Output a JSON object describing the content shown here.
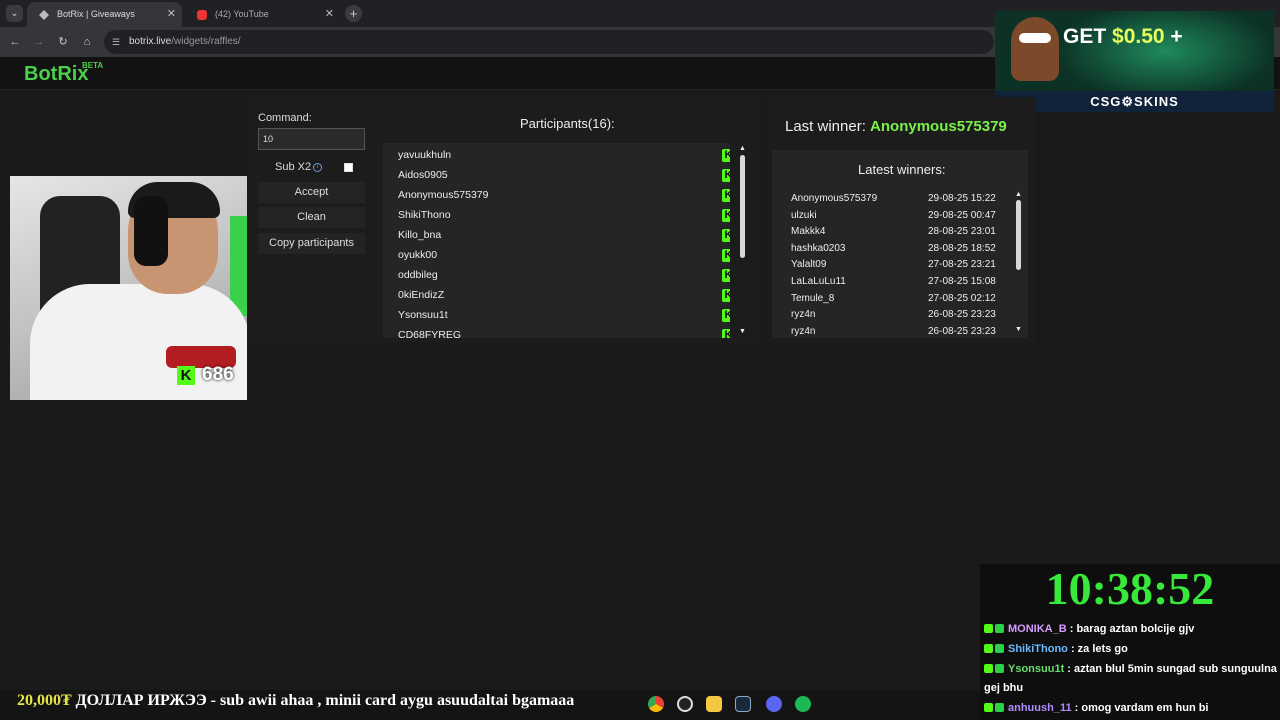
{
  "browser": {
    "tabs": [
      {
        "label": "BotRix | Giveaways"
      },
      {
        "label": "(42) YouTube"
      }
    ],
    "url_host": "botrix.live",
    "url_path": "/widgets/raffles/"
  },
  "header": {
    "logo": "BotRix",
    "beta": "BETA"
  },
  "ad": {
    "get": "GET",
    "amount": "$0.50",
    "plus": "+",
    "brand": "CSG⚙SKINS"
  },
  "controls": {
    "command_label": "Command:",
    "command_value": "10",
    "sub_label": "Sub X2",
    "accept": "Accept",
    "clean": "Clean",
    "copy": "Copy participants"
  },
  "participants": {
    "title": "Participants(16):",
    "items": [
      "yavuukhuln",
      "Aidos0905",
      "Anonymous575379",
      "ShikiThono",
      "Killo_bna",
      "oyukk00",
      "oddbileg",
      "0kiEndizZ",
      "Ysonsuu1t",
      "CD68FYREG"
    ]
  },
  "winners": {
    "last_label": "Last winner:",
    "last_name": "Anonymous575379",
    "title": "Latest winners:",
    "rows": [
      {
        "name": "Anonymous575379",
        "when": "29-08-25 15:22"
      },
      {
        "name": "ulzuki",
        "when": "29-08-25 00:47"
      },
      {
        "name": "Makkk4",
        "when": "28-08-25 23:01"
      },
      {
        "name": "hashka0203",
        "when": "28-08-25 18:52"
      },
      {
        "name": "Yalalt09",
        "when": "27-08-25 23:21"
      },
      {
        "name": "LaLaLuLu11",
        "when": "27-08-25 15:08"
      },
      {
        "name": "Temule_8",
        "when": "27-08-25 02:12"
      },
      {
        "name": "ryz4n",
        "when": "26-08-25 23:23"
      },
      {
        "name": "ryz4n",
        "when": "26-08-25 23:23"
      }
    ]
  },
  "stream": {
    "viewer_count": "686",
    "clock": "10:38:52",
    "chat": [
      {
        "user": "MONIKA_B",
        "msg": ": barag aztan bolcije gjv",
        "color": "#d89bff"
      },
      {
        "user": "ShikiThono",
        "msg": ": za lets go",
        "color": "#6ab8ff"
      },
      {
        "user": "Ysonsuu1t",
        "msg": ": aztan blul 5min sungad sub sunguulna gej bhu",
        "color": "#6adf6a"
      },
      {
        "user": "anhuush_11",
        "msg": ": omog vardam em hun bi",
        "color": "#b08cff"
      }
    ],
    "ticker_amount": "20,000₮",
    "ticker_text": "ДОЛЛАР ИРЖЭЭ - sub awii ahaa , minii card aygu asuudaltai bgamaaa"
  },
  "colors": {
    "accent_green": "#53fc18",
    "winner_green": "#7cf04a",
    "clock_green": "#38e83a"
  },
  "icons": [
    "back-icon",
    "forward-icon",
    "reload-icon",
    "home-icon",
    "site-info-icon",
    "kick-icon",
    "info-icon",
    "chrome-icon",
    "github-icon",
    "folder-icon",
    "steam-icon",
    "discord-icon",
    "spotify-icon"
  ]
}
